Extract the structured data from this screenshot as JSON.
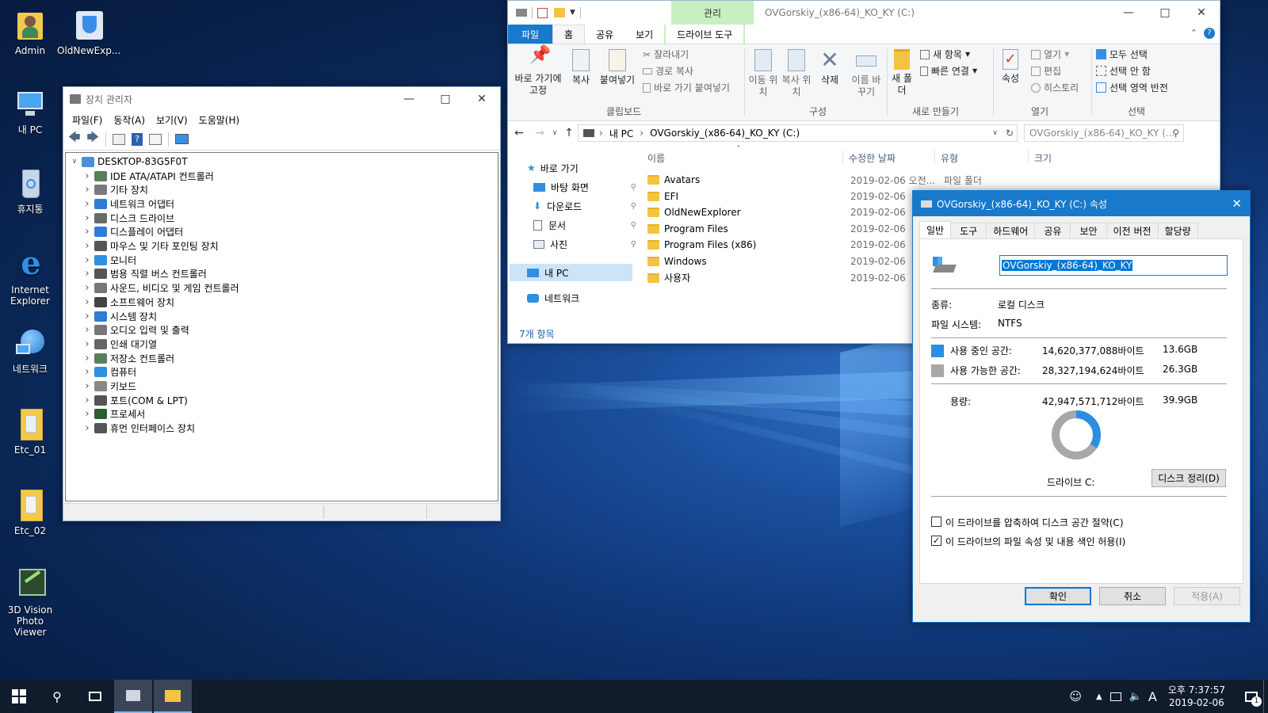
{
  "desktop": {
    "icons": [
      {
        "label": "Admin"
      },
      {
        "label": "OldNewExp..."
      },
      {
        "label": "내 PC"
      },
      {
        "label": "휴지통"
      },
      {
        "label": "Internet Explorer"
      },
      {
        "label": "네트워크"
      },
      {
        "label": "Etc_01"
      },
      {
        "label": "Etc_02"
      },
      {
        "label": "3D Vision Photo Viewer"
      }
    ]
  },
  "device_manager": {
    "title": "장치 관리자",
    "menu": [
      "파일(F)",
      "동작(A)",
      "보기(V)",
      "도움말(H)"
    ],
    "root": "DESKTOP-83G5F0T",
    "categories": [
      {
        "label": "IDE ATA/ATAPI 컨트롤러",
        "color": "#5a7f5a"
      },
      {
        "label": "기타 장치",
        "color": "#7a7a7a"
      },
      {
        "label": "네트워크 어댑터",
        "color": "#2f7bd6"
      },
      {
        "label": "디스크 드라이브",
        "color": "#6a6a6a"
      },
      {
        "label": "디스플레이 어댑터",
        "color": "#2f7bd6"
      },
      {
        "label": "마우스 및 기타 포인팅 장치",
        "color": "#555555"
      },
      {
        "label": "모니터",
        "color": "#2f8fe0"
      },
      {
        "label": "범용 직렬 버스 컨트롤러",
        "color": "#555555"
      },
      {
        "label": "사운드, 비디오 및 게임 컨트롤러",
        "color": "#777777"
      },
      {
        "label": "소프트웨어 장치",
        "color": "#444444"
      },
      {
        "label": "시스템 장치",
        "color": "#2f7bd6"
      },
      {
        "label": "오디오 입력 및 출력",
        "color": "#777777"
      },
      {
        "label": "인쇄 대기열",
        "color": "#666666"
      },
      {
        "label": "저장소 컨트롤러",
        "color": "#5a7f5a"
      },
      {
        "label": "컴퓨터",
        "color": "#2f8fe0"
      },
      {
        "label": "키보드",
        "color": "#888888"
      },
      {
        "label": "포트(COM & LPT)",
        "color": "#555555"
      },
      {
        "label": "프로세서",
        "color": "#2e5e2e"
      },
      {
        "label": "휴먼 인터페이스 장치",
        "color": "#555555"
      }
    ]
  },
  "explorer": {
    "title": "OVGorskiy_(x86-64)_KO_KY (C:)",
    "context_tab": "관리",
    "tabs": [
      "파일",
      "홈",
      "공유",
      "보기",
      "드라이브 도구"
    ],
    "ribbon": {
      "pin": "바로 가기에 고정",
      "copy": "복사",
      "paste": "붙여넣기",
      "cut": "잘라내기",
      "copy_path": "경로 복사",
      "paste_shortcut": "바로 가기 붙여넣기",
      "clipboard_group": "클립보드",
      "move_to": "이동 위치",
      "copy_to": "복사 위치",
      "delete": "삭제",
      "rename": "이름 바꾸기",
      "organize_group": "구성",
      "new_folder": "새 폴더",
      "new_item": "새 항목",
      "easy_access": "빠른 연결",
      "new_group": "새로 만들기",
      "properties": "속성",
      "open": "열기",
      "edit": "편집",
      "history": "히스토리",
      "open_group": "열기",
      "select_all": "모두 선택",
      "select_none": "선택 안 함",
      "invert_selection": "선택 영역 반전",
      "select_group": "선택"
    },
    "address": {
      "part1": "내 PC",
      "part2": "OVGorskiy_(x86-64)_KO_KY (C:)"
    },
    "search_placeholder": "OVGorskiy_(x86-64)_KO_KY (...",
    "nav": {
      "quick_access": "바로 가기",
      "items": [
        "바탕 화면",
        "다운로드",
        "문서",
        "사진"
      ],
      "this_pc": "내 PC",
      "network": "네트워크"
    },
    "columns": {
      "name": "이름",
      "modified": "수정한 날짜",
      "type": "유형",
      "size": "크기"
    },
    "files": [
      {
        "name": "Avatars",
        "date": "2019-02-06 오전...",
        "type": "파일 폴더"
      },
      {
        "name": "EFI",
        "date": "2019-02-06",
        "type": ""
      },
      {
        "name": "OldNewExplorer",
        "date": "2019-02-06",
        "type": ""
      },
      {
        "name": "Program Files",
        "date": "2019-02-06",
        "type": ""
      },
      {
        "name": "Program Files (x86)",
        "date": "2019-02-06",
        "type": ""
      },
      {
        "name": "Windows",
        "date": "2019-02-06",
        "type": ""
      },
      {
        "name": "사용자",
        "date": "2019-02-06",
        "type": ""
      }
    ],
    "status": "7개 항목"
  },
  "properties": {
    "title": "OVGorskiy_(x86-64)_KO_KY (C:) 속성",
    "tabs": [
      "일반",
      "도구",
      "하드웨어",
      "공유",
      "보안",
      "이전 버전",
      "할당량"
    ],
    "name_value": "OVGorskiy_(x86-64)_KO_KY",
    "type_label": "종류:",
    "type_value": "로컬 디스크",
    "fs_label": "파일 시스템:",
    "fs_value": "NTFS",
    "used_label": "사용 중인 공간:",
    "used_bytes": "14,620,377,088바이트",
    "used_gb": "13.6GB",
    "free_label": "사용 가능한 공간:",
    "free_bytes": "28,327,194,624바이트",
    "free_gb": "26.3GB",
    "capacity_label": "용량:",
    "capacity_bytes": "42,947,571,712바이트",
    "capacity_gb": "39.9GB",
    "used_fraction": 0.34,
    "used_color": "#2b8ee0",
    "free_color": "#a8a8a8",
    "drive_label": "드라이브 C:",
    "cleanup_button": "디스크 정리(D)",
    "compress_label": "이 드라이브를 압축하여 디스크 공간 절약(C)",
    "compress_checked": false,
    "index_label": "이 드라이브의 파일 속성 및 내용 색인 허용(I)",
    "index_checked": true,
    "ok": "확인",
    "cancel": "취소",
    "apply": "적용(A)"
  },
  "taskbar": {
    "time": "오후 7:37:57",
    "date": "2019-02-06",
    "ime": "A",
    "notifications": "1"
  }
}
